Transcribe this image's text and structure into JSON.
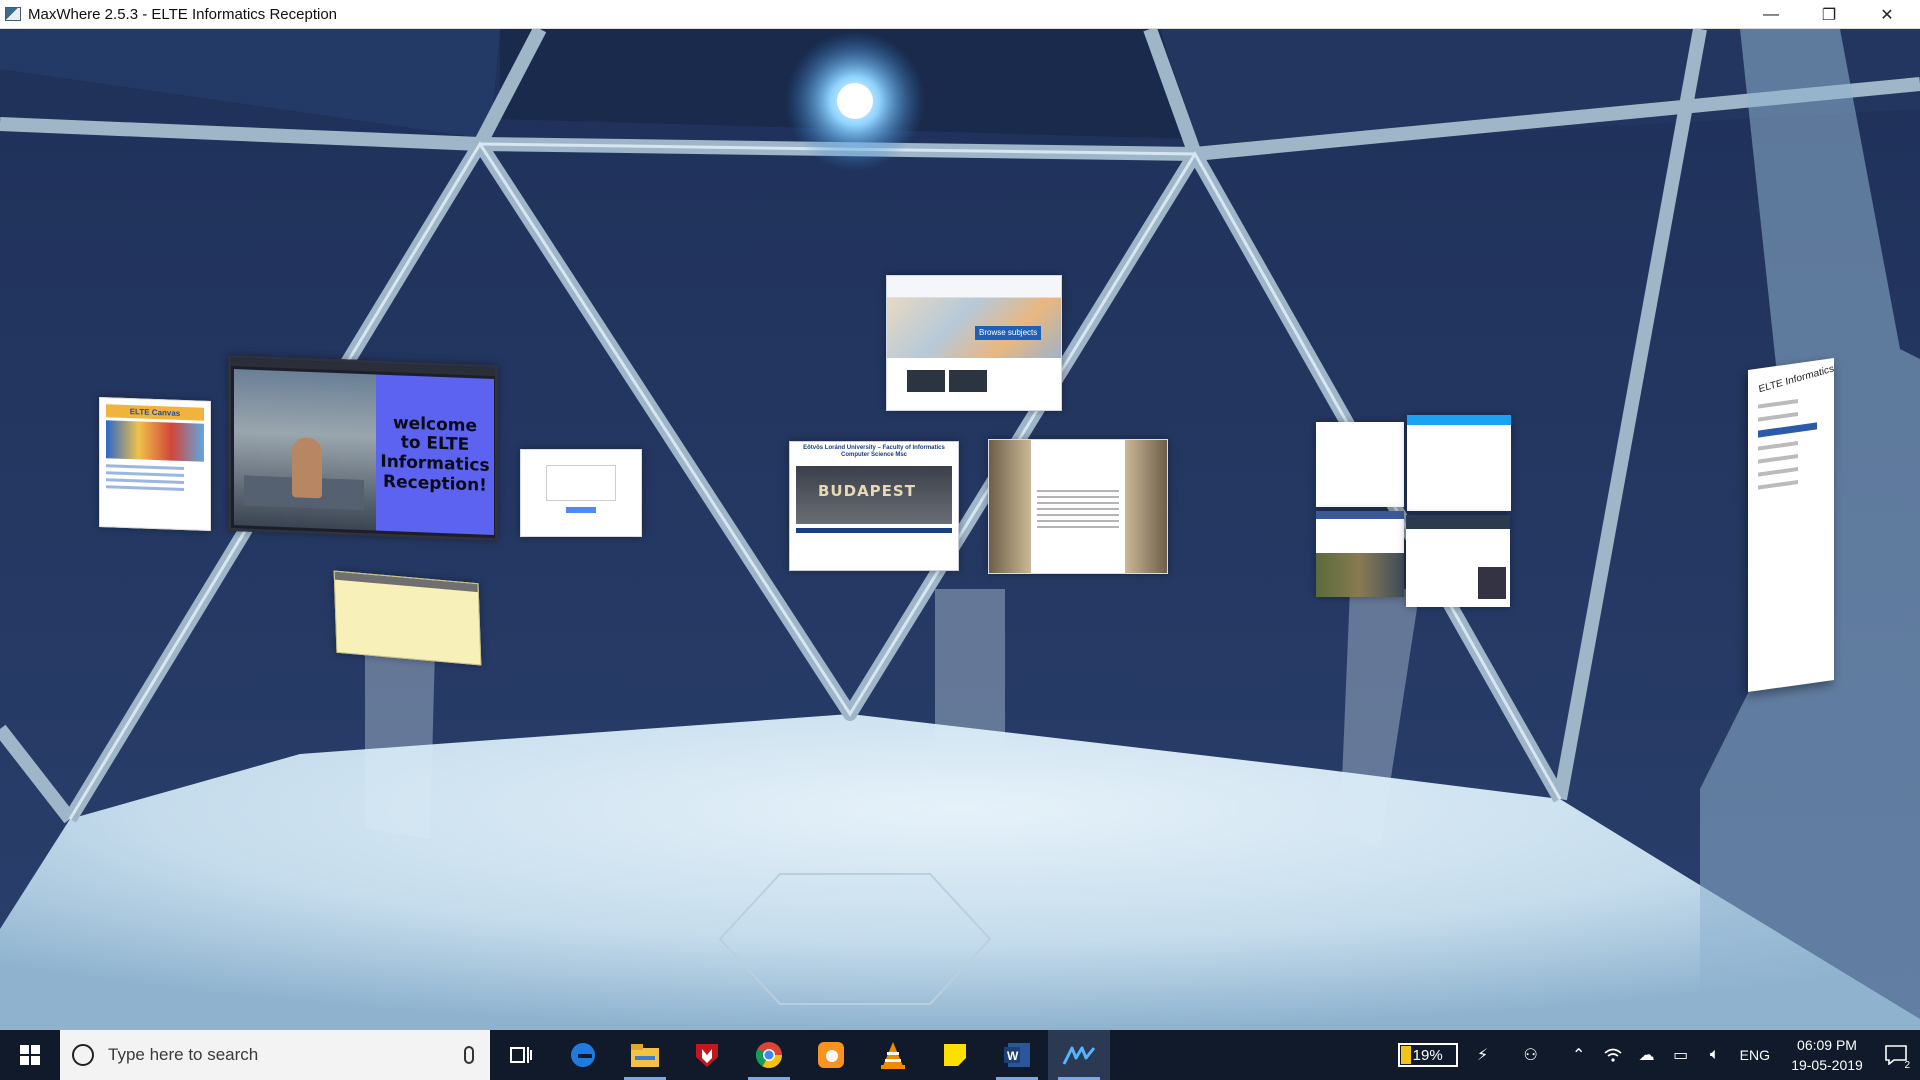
{
  "window": {
    "title": "MaxWhere 2.5.3 - ELTE Informatics Reception",
    "controls": {
      "minimize": "—",
      "restore": "❐",
      "close": "✕"
    }
  },
  "scene": {
    "panels": {
      "canvas_title": "ELTE Canvas",
      "welcome_slide": "welcome\nto ELTE\nInformatics\nReception!",
      "subjects_button": "Browse subjects",
      "csmsc_title": "Eötvös Loránd University – Faculty of Informatics\nComputer Science Msc",
      "csmsc_banner": "BUDAPEST",
      "reception_title": "ELTE Informatics Reception"
    }
  },
  "taskbar": {
    "search_placeholder": "Type here to search",
    "apps": [
      "task-view",
      "edge",
      "file-explorer",
      "mcafee",
      "chrome",
      "uc-browser",
      "vlc",
      "sticky-notes",
      "word",
      "maxwhere"
    ],
    "tray": {
      "battery": "19%",
      "language": "ENG",
      "time": "06:09 PM",
      "date": "19-05-2019",
      "notifications": "2"
    }
  }
}
